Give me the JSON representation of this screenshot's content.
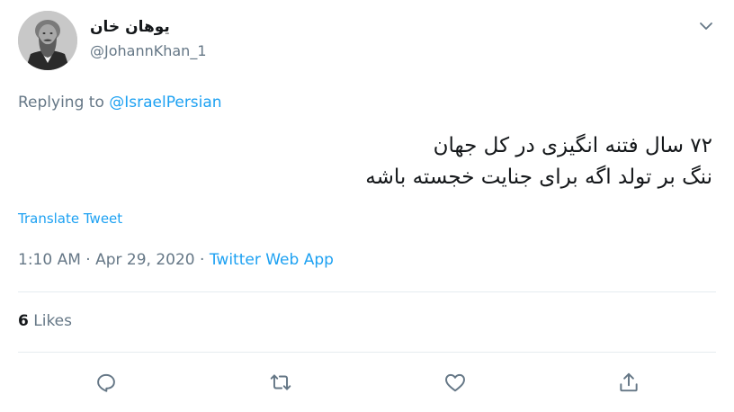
{
  "user": {
    "display_name": "یوهان خان",
    "handle": "@JohannKhan_1"
  },
  "reply": {
    "prefix": "Replying to",
    "handle": "@IsraelPersian"
  },
  "tweet": {
    "lines": [
      "۷۲ سال فتنه انگیزی در کل جهان",
      "ننگ بر تولد اگه برای جنایت خجسته باشه"
    ]
  },
  "translate_label": "Translate Tweet",
  "meta": {
    "time": "1:10 AM",
    "date": "Apr 29, 2020",
    "separator": "·",
    "source": "Twitter Web App"
  },
  "stats": {
    "likes_count": "6",
    "likes_label": "Likes"
  },
  "icons": {
    "avatar": "portrait-photo",
    "caret": "chevron-down-icon",
    "reply": "reply-icon",
    "retweet": "retweet-icon",
    "like": "heart-icon",
    "share": "share-icon"
  },
  "colors": {
    "link": "#1da1f2",
    "secondary_text": "#657786",
    "primary_text": "#14171a",
    "divider": "#e6ecf0"
  }
}
